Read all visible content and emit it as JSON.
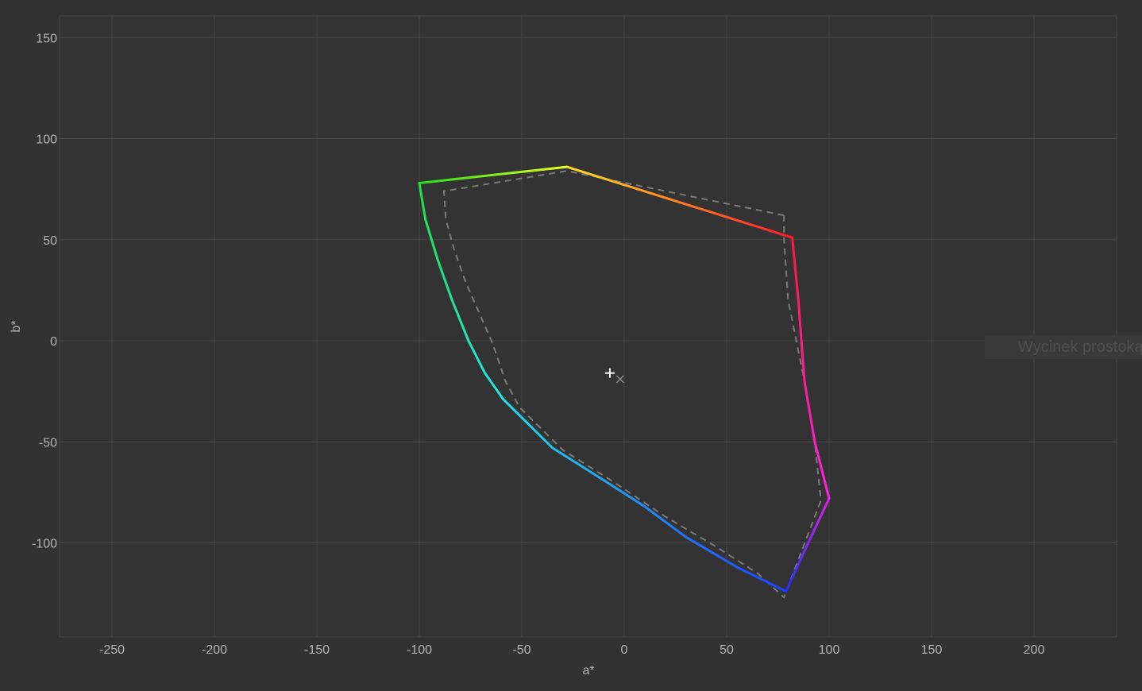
{
  "chart_data": {
    "type": "line",
    "xlabel": "a*",
    "ylabel": "b*",
    "xlim": [
      -275,
      240
    ],
    "ylim": [
      -146,
      160
    ],
    "grid": true,
    "x_ticks": [
      -250,
      -200,
      -150,
      -100,
      -50,
      0,
      50,
      100,
      150,
      200
    ],
    "y_ticks": [
      150,
      100,
      50,
      0,
      -50,
      -100
    ],
    "x_tick_labels": [
      "-250",
      "-200",
      "-150",
      "-100",
      "-50",
      "0",
      "50",
      "100",
      "150",
      "200"
    ],
    "y_tick_labels": [
      "150",
      "100",
      "50",
      "0",
      "-50",
      "-100"
    ],
    "series": [
      {
        "style": "solid-gradient",
        "edges": [
          {
            "from": "red",
            "to": "yellow",
            "colors": [
              "#ff1a2a",
              "#ffe020"
            ],
            "x": [
              82,
              -28
            ],
            "y": [
              51,
              86
            ]
          },
          {
            "from": "yellow",
            "to": "green",
            "colors": [
              "#e6ff20",
              "#20e020"
            ],
            "x": [
              -28,
              -100
            ],
            "y": [
              86,
              78
            ]
          },
          {
            "from": "green",
            "to": "cyan",
            "colors": [
              "#20e040",
              "#20e8e8"
            ],
            "x": [
              -100,
              -97,
              -91,
              -84,
              -76,
              -68,
              -59
            ],
            "y": [
              78,
              60,
              40,
              20,
              0,
              -16,
              -29
            ]
          },
          {
            "from": "cyan",
            "to": "blue",
            "colors": [
              "#20e0e8",
              "#2040ff"
            ],
            "x": [
              -59,
              -35,
              -10,
              10,
              30,
              55,
              79
            ],
            "y": [
              -29,
              -53,
              -69,
              -82,
              -97,
              -112,
              -124
            ]
          },
          {
            "from": "blue",
            "to": "magenta",
            "colors": [
              "#2030ff",
              "#e020e8"
            ],
            "x": [
              79,
              88,
              100
            ],
            "y": [
              -124,
              -104,
              -78
            ]
          },
          {
            "from": "magenta",
            "to": "red",
            "colors": [
              "#ff20e8",
              "#ff1a3a"
            ],
            "x": [
              100,
              93,
              88,
              85,
              82
            ],
            "y": [
              -78,
              -50,
              -20,
              20,
              51
            ]
          }
        ]
      },
      {
        "style": "dashed",
        "color": "#7a7a7a",
        "x": [
          78,
          -28,
          -88,
          -87,
          -83,
          -77,
          -70,
          -64,
          -58,
          -51,
          -30,
          -5,
          20,
          45,
          65,
          78,
          96,
          93,
          88,
          80,
          78,
          78
        ],
        "y": [
          62,
          84,
          74,
          60,
          45,
          28,
          12,
          -2,
          -20,
          -33,
          -54,
          -70,
          -87,
          -102,
          -115,
          -127,
          -79,
          -50,
          -20,
          20,
          50,
          62
        ]
      }
    ],
    "markers": [
      {
        "symbol": "+",
        "x": -7,
        "y": -16,
        "color": "#ffffff"
      },
      {
        "symbol": "x",
        "x": -2,
        "y": -19,
        "color": "#8a8a8a"
      }
    ]
  },
  "tooltip": {
    "text": "Wycinek prostokątny"
  }
}
